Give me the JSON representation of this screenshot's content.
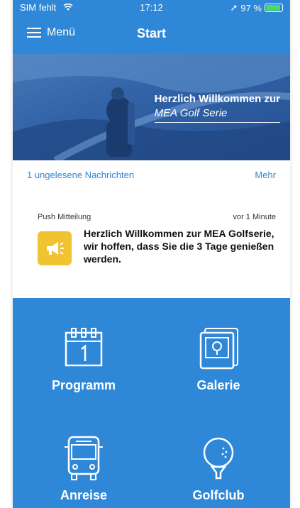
{
  "status": {
    "carrier": "SIM fehlt",
    "time": "17:12",
    "battery": "97 %"
  },
  "nav": {
    "menu_label": "Menü",
    "title": "Start"
  },
  "hero": {
    "line1": "Herzlich Willkommen zur",
    "line2": "MEA Golf Serie"
  },
  "messages": {
    "unread": "1 ungelesene Nachrichten",
    "more": "Mehr"
  },
  "notice": {
    "type": "Push Mitteilung",
    "time": "vor 1 Minute",
    "text": "Herzlich Willkommen zur MEA Golfserie, wir hoffen, dass Sie die 3 Tage genießen werden."
  },
  "tiles": [
    {
      "label": "Programm",
      "icon": "calendar-icon"
    },
    {
      "label": "Galerie",
      "icon": "gallery-icon"
    },
    {
      "label": "Anreise",
      "icon": "bus-icon"
    },
    {
      "label": "Golfclub",
      "icon": "golf-ball-icon"
    }
  ],
  "colors": {
    "primary": "#2f87d8",
    "notice_icon": "#f1c232"
  }
}
